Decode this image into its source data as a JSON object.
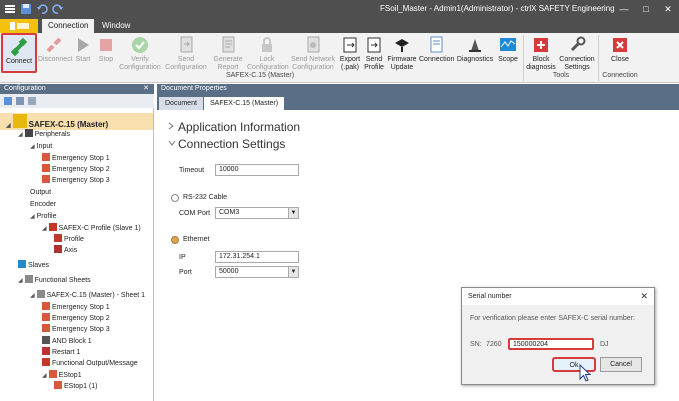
{
  "window": {
    "title": "FSoil_Master - Admin1(Administrator) - ctrlX SAFETY Engineering",
    "minimize": "—",
    "maximize": "□",
    "close": "✕"
  },
  "ribbon_tabs": [
    "Connection",
    "Window"
  ],
  "ribbon": {
    "buttons": [
      {
        "label": "Connect",
        "icon": "plug-connect-icon",
        "enabled": true,
        "selected": true
      },
      {
        "label": "Disconnect",
        "icon": "plug-disconnect-icon",
        "enabled": false
      },
      {
        "label": "Start",
        "icon": "play-icon",
        "enabled": false
      },
      {
        "label": "Stop",
        "icon": "stop-icon",
        "enabled": false
      },
      {
        "label": "Verify Configuration",
        "icon": "checkmark-icon",
        "enabled": false
      },
      {
        "label": "Send Configuration",
        "icon": "send-document-icon",
        "enabled": false
      },
      {
        "label": "Generate Report",
        "icon": "report-icon",
        "enabled": false
      },
      {
        "label": "Lock Configuration",
        "icon": "lock-icon",
        "enabled": false
      },
      {
        "label": "Send Network Configuration",
        "icon": "network-doc-icon",
        "enabled": false
      },
      {
        "label": "Export (.pak)",
        "icon": "export-icon",
        "enabled": true
      },
      {
        "label": "Send Profile",
        "icon": "send-profile-icon",
        "enabled": true
      },
      {
        "label": "Firmware Update",
        "icon": "firmware-icon",
        "enabled": true
      },
      {
        "label": "Connection",
        "icon": "connection-doc-icon",
        "enabled": true
      },
      {
        "label": "Diagnostics",
        "icon": "diagnostics-icon",
        "enabled": true
      },
      {
        "label": "Scope",
        "icon": "scope-icon",
        "enabled": true
      },
      {
        "label": "Block diagnosis",
        "icon": "block-diagnosis-icon",
        "enabled": true
      },
      {
        "label": "Connection Settings",
        "icon": "wrench-icon",
        "enabled": true
      },
      {
        "label": "Close",
        "icon": "close-red-icon",
        "enabled": true
      }
    ],
    "groups": [
      "SAFEX-C.15 (Master)",
      "Tools",
      "Connection"
    ]
  },
  "left_panel": {
    "title": "Configuration",
    "pin": "✕",
    "tree": [
      {
        "label": "SAFEX-C.15 (Master)",
        "icon": "device-icon",
        "level": 0,
        "bold": true,
        "expander": "◢"
      },
      {
        "label": "Peripherals",
        "icon": "gear-icon",
        "level": 1,
        "expander": "◢"
      },
      {
        "label": "Input",
        "icon": "",
        "level": 2,
        "expander": "◢"
      },
      {
        "label": "Emergency Stop 1",
        "icon": "estop-icon",
        "level": 3
      },
      {
        "label": "Emergency Stop 2",
        "icon": "estop-icon",
        "level": 3
      },
      {
        "label": "Emergency Stop 3",
        "icon": "estop-icon",
        "level": 3
      },
      {
        "label": "Output",
        "icon": "",
        "level": 2
      },
      {
        "label": "Encoder",
        "icon": "",
        "level": 2
      },
      {
        "label": "Profile",
        "icon": "",
        "level": 2,
        "expander": "◢"
      },
      {
        "label": "SAFEX-C Profile (Slave 1)",
        "icon": "profile-icon",
        "level": 3,
        "expander": "◢"
      },
      {
        "label": "Profile",
        "icon": "profile-small-icon",
        "level": 4
      },
      {
        "label": "Axis",
        "icon": "axis-icon",
        "level": 4
      },
      {
        "label": "Slaves",
        "icon": "slaves-icon",
        "level": 1,
        "expander": ""
      },
      {
        "label": "Functional Sheets",
        "icon": "sheets-icon",
        "level": 1,
        "expander": "◢"
      },
      {
        "label": "SAFEX-C.15 (Master) - Sheet 1",
        "icon": "sheet-icon",
        "level": 2,
        "expander": "◢"
      },
      {
        "label": "Emergency Stop 1",
        "icon": "estop-icon",
        "level": 3
      },
      {
        "label": "Emergency Stop 2",
        "icon": "estop-icon",
        "level": 3
      },
      {
        "label": "Emergency Stop 3",
        "icon": "estop-icon",
        "level": 3
      },
      {
        "label": "AND Block 1",
        "icon": "and-block-icon",
        "level": 3
      },
      {
        "label": "Restart 1",
        "icon": "restart-icon",
        "level": 3
      },
      {
        "label": "Functional Output/Message",
        "icon": "func-output-icon",
        "level": 3
      },
      {
        "label": "EStop1",
        "icon": "estop-group-icon",
        "level": 3,
        "expander": "◢"
      },
      {
        "label": "EStop1 (1)",
        "icon": "estop-icon",
        "level": 4
      }
    ]
  },
  "document": {
    "panel_title": "Document Properties",
    "tabs": [
      "Document",
      "SAFEX-C.15 (Master)"
    ],
    "app_info": "Application Information",
    "conn_settings": "Connection Settings",
    "timeout_label": "Timeout",
    "timeout_value": "10000",
    "rs232_label": "RS-232 Cable",
    "comport_label": "COM Port",
    "comport_value": "COM3",
    "ethernet_label": "Ethernet",
    "ip_label": "IP",
    "ip_value": "172.31.254.1",
    "port_label": "Port",
    "port_value": "50000"
  },
  "dialog": {
    "title": "Serial number",
    "message": "For verification please enter SAFEX-C serial number:",
    "sn_label": "SN:",
    "sn_prefix": "7260",
    "sn_value": "150000204",
    "sn_suffix": "DJ",
    "ok": "Ok",
    "cancel": "Cancel",
    "close": "✕"
  },
  "colors": {
    "accent_red": "#d63a3a",
    "panel_header": "#5a6e86",
    "selection": "#f8dfae",
    "file_tab": "#f4c20d"
  }
}
